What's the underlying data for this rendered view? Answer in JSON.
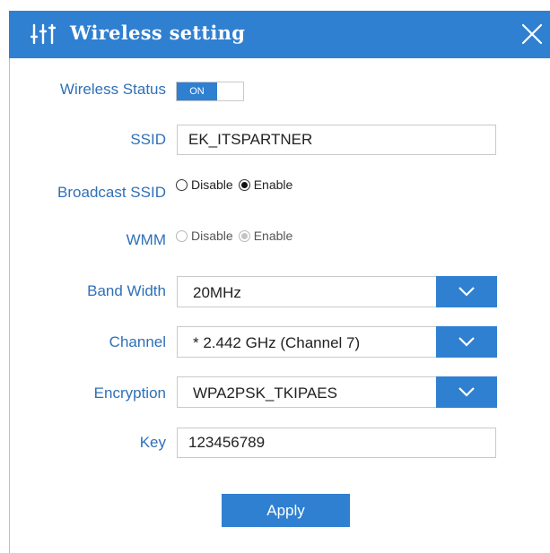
{
  "dialog": {
    "title": "Wireless setting",
    "icon": "sliders-icon",
    "close_icon": "close-icon",
    "accent_color": "#2f80d1",
    "label_color": "#2f70b8"
  },
  "fields": {
    "wireless_status": {
      "label": "Wireless Status",
      "toggle_text": "ON"
    },
    "ssid": {
      "label": "SSID",
      "value": "EK_ITSPARTNER"
    },
    "broadcast_ssid": {
      "label": "Broadcast SSID",
      "option_disable": "Disable",
      "option_enable": "Enable",
      "selected": "Enable"
    },
    "wmm": {
      "label": "WMM",
      "option_disable": "Disable",
      "option_enable": "Enable",
      "selected": "Enable",
      "disabled": true
    },
    "band_width": {
      "label": "Band Width",
      "value": "20MHz"
    },
    "channel": {
      "label": "Channel",
      "value": "* 2.442 GHz (Channel 7)"
    },
    "encryption": {
      "label": "Encryption",
      "value": "WPA2PSK_TKIPAES"
    },
    "key": {
      "label": "Key",
      "value": "123456789"
    }
  },
  "actions": {
    "apply_label": "Apply"
  }
}
